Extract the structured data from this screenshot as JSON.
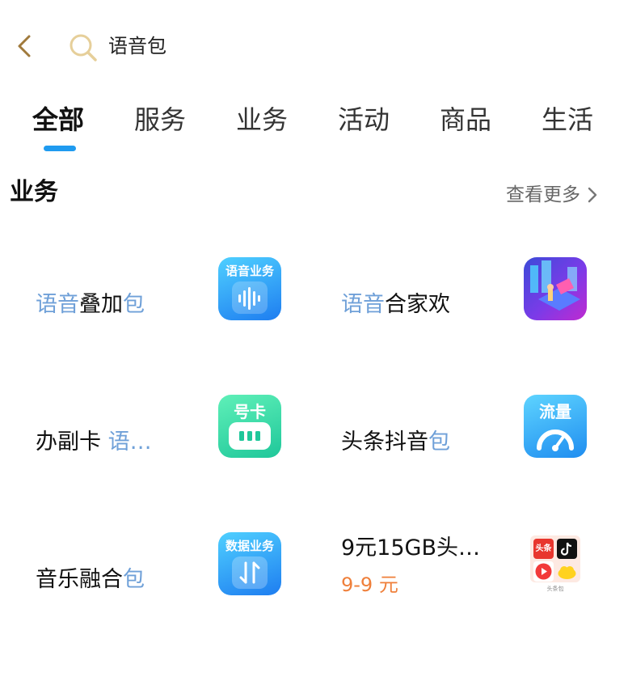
{
  "search": {
    "query": "语音包"
  },
  "tabs": [
    "全部",
    "服务",
    "业务",
    "活动",
    "商品",
    "生活"
  ],
  "active_tab": "全部",
  "section": {
    "title": "业务",
    "more_label": "查看更多"
  },
  "items": [
    {
      "parts": [
        {
          "t": "语音",
          "hl": true
        },
        {
          "t": "叠加",
          "hl": false
        },
        {
          "t": "包",
          "hl": true
        }
      ],
      "icon_name": "voice-service-icon",
      "icon_label": "语音业务"
    },
    {
      "parts": [
        {
          "t": "语音",
          "hl": true
        },
        {
          "t": "合家欢",
          "hl": false
        }
      ],
      "icon_name": "family-plan-icon",
      "icon_label": ""
    },
    {
      "parts": [
        {
          "t": "办副卡 ",
          "hl": false
        },
        {
          "t": "语…",
          "hl": true
        }
      ],
      "icon_name": "sim-card-icon",
      "icon_label": "号卡"
    },
    {
      "parts": [
        {
          "t": "头条抖音",
          "hl": false
        },
        {
          "t": "包",
          "hl": true
        }
      ],
      "icon_name": "data-flow-icon",
      "icon_label": "流量"
    },
    {
      "parts": [
        {
          "t": "音乐融合",
          "hl": false
        },
        {
          "t": "包",
          "hl": true
        }
      ],
      "icon_name": "data-service-icon",
      "icon_label": "数据业务"
    },
    {
      "parts": [
        {
          "t": "9元15GB头…",
          "hl": false
        }
      ],
      "price": "9-9 元",
      "icon_name": "app-bundle-icon",
      "icon_label": "头条",
      "icon_caption": "头条包"
    }
  ],
  "colors": {
    "accent": "#1f9bf0",
    "highlight": "#6fa0d8",
    "price": "#ef7f3a"
  }
}
